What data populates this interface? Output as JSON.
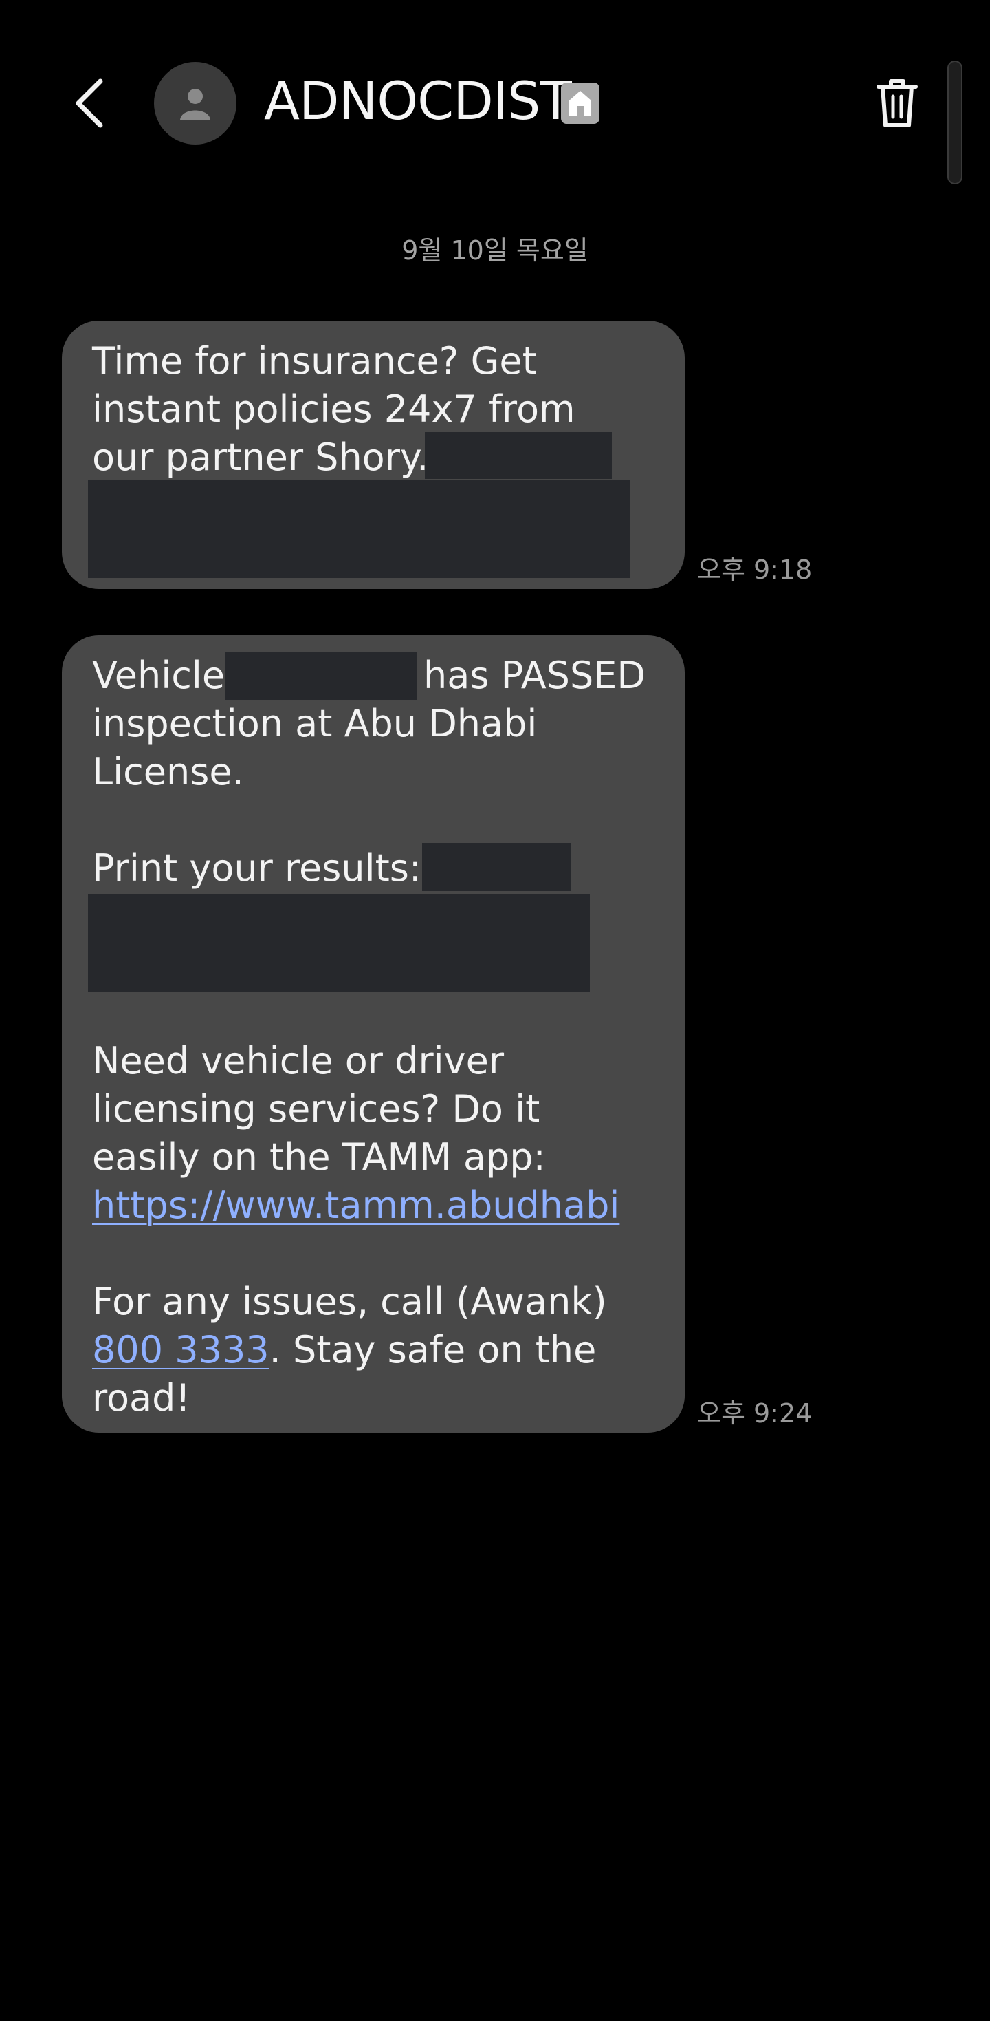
{
  "header": {
    "contact_name": "ADNOCDIST",
    "back_icon": "chevron-left-icon",
    "avatar_icon": "person-icon",
    "badge_icon": "house-icon",
    "delete_icon": "trash-icon"
  },
  "date_separator": "9월 10일 목요일",
  "messages": [
    {
      "lines": [
        "Time for insurance? Get",
        "instant policies 24x7 from",
        "our partner Shory."
      ],
      "time": "오후 9:18"
    },
    {
      "line1_a": "Vehicle",
      "line1_b": "has PASSED",
      "line2": "inspection at Abu Dhabi",
      "line3": "License.",
      "line4": "Print your results:",
      "line5": "Need vehicle or driver",
      "line6": "licensing services? Do it",
      "line7": "easily on the TAMM app:",
      "link_url": "https://www.tamm.abudhabi",
      "line9": "For any issues, call (Awank)",
      "phone": "800 3333",
      "line10_rest": ". Stay safe on the",
      "line11": "road!",
      "time": "오후 9:24"
    }
  ],
  "colors": {
    "background": "#000000",
    "bubble": "#484848",
    "link": "#8fb0ff",
    "redaction": "#26282c"
  }
}
